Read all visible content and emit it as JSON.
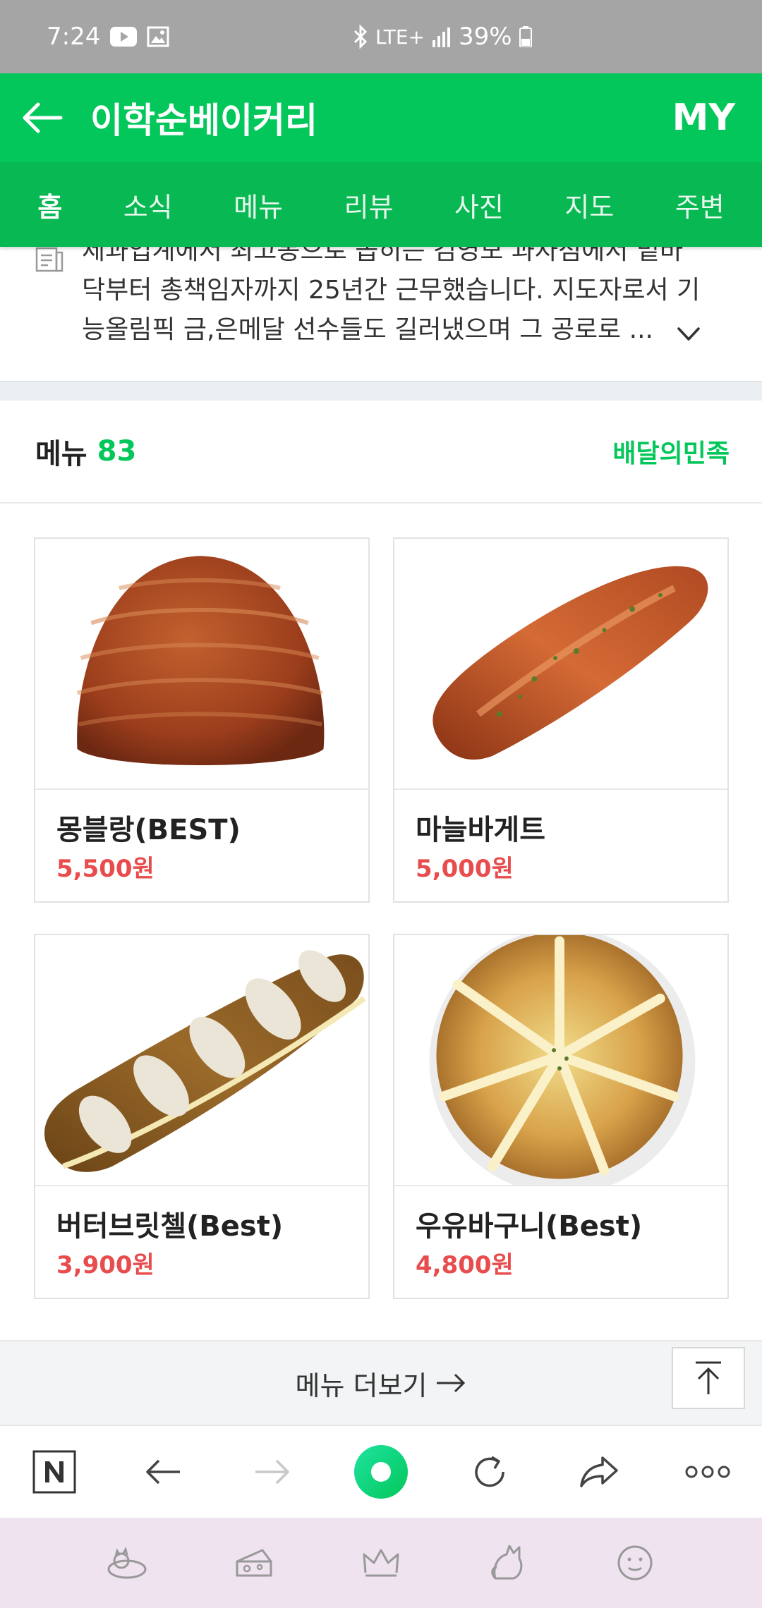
{
  "status_bar": {
    "time": "7:24",
    "network": "LTE+",
    "battery": "39%"
  },
  "header": {
    "title": "이학순베이커리",
    "my_label": "MY"
  },
  "tabs": [
    {
      "label": "홈",
      "active": true
    },
    {
      "label": "소식",
      "active": false
    },
    {
      "label": "메뉴",
      "active": false
    },
    {
      "label": "리뷰",
      "active": false
    },
    {
      "label": "사진",
      "active": false
    },
    {
      "label": "지도",
      "active": false
    },
    {
      "label": "주변",
      "active": false
    }
  ],
  "description": {
    "line1": "제과업계에서 최고봉으로 꼽히는 김영모 과자점에서 밑바",
    "line2": "닥부터 총책임자까지 25년간 근무했습니다. 지도자로서 기",
    "line3": "능올림픽 금,은메달 선수들도 길러냈으며 그 공로로 ..."
  },
  "menu_section": {
    "title": "메뉴",
    "count": "83",
    "delivery_link": "배달의민족"
  },
  "menu_items": [
    {
      "name": "몽블랑(BEST)",
      "price": "5,500원"
    },
    {
      "name": "마늘바게트",
      "price": "5,000원"
    },
    {
      "name": "버터브릿첼(Best)",
      "price": "3,900원"
    },
    {
      "name": "우유바구니(Best)",
      "price": "4,800원"
    }
  ],
  "more_menu": {
    "label": "메뉴 더보기"
  },
  "colors": {
    "brand_green": "#03c75a",
    "price_red": "#e94c4c",
    "status_bar": "#a5a5a5",
    "nav_bar": "#efe3ef"
  },
  "icons": {
    "status_left": [
      "youtube-icon",
      "gallery-icon"
    ],
    "status_center": [
      "bluetooth-icon",
      "lte-icon",
      "signal-icon",
      "battery-icon"
    ],
    "browser_toolbar": [
      "naver-n-icon",
      "back-arrow-icon",
      "forward-arrow-icon",
      "green-dot-icon",
      "refresh-icon",
      "share-icon",
      "more-dots-icon"
    ],
    "system_nav": [
      "cat-sleep-icon",
      "cheese-icon",
      "crown-icon",
      "cat-icon",
      "smile-face-icon"
    ]
  }
}
